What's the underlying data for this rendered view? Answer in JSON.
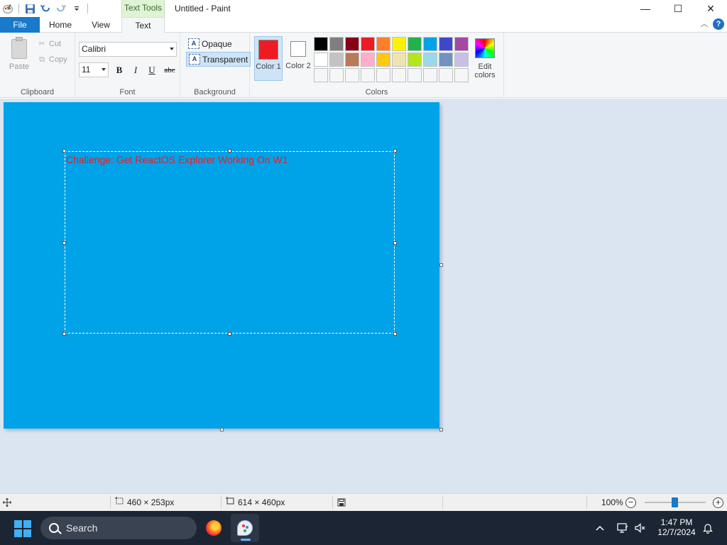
{
  "window": {
    "title": "Untitled - Paint",
    "context_tab": "Text Tools",
    "min": "—",
    "max": "☐",
    "close": "✕"
  },
  "tabs": {
    "file": "File",
    "home": "Home",
    "view": "View",
    "text": "Text"
  },
  "ribbon": {
    "clipboard": {
      "label": "Clipboard",
      "paste": "Paste",
      "cut": "Cut",
      "copy": "Copy"
    },
    "font": {
      "label": "Font",
      "name": "Calibri",
      "size": "11",
      "bold": "B",
      "italic": "I",
      "underline": "U",
      "strike": "abc"
    },
    "background": {
      "label": "Background",
      "opaque": "Opaque",
      "transparent": "Transparent",
      "selected": "transparent"
    },
    "colors": {
      "label": "Colors",
      "color1_label": "Color 1",
      "color2_label": "Color 2",
      "color1": "#ed1c24",
      "color2": "#ffffff",
      "edit_label": "Edit colors",
      "palette_row1": [
        "#000000",
        "#7f7f7f",
        "#880015",
        "#ed1c24",
        "#ff7f27",
        "#fff200",
        "#22b14c",
        "#00a2e8",
        "#3f48cc",
        "#a349a4"
      ],
      "palette_row2": [
        "#ffffff",
        "#c3c3c3",
        "#b97a57",
        "#ffaec9",
        "#ffc90e",
        "#efe4b0",
        "#b5e61d",
        "#99d9ea",
        "#7092be",
        "#c8bfe7"
      ]
    }
  },
  "canvas": {
    "background": "#00a2e8",
    "text": "Challenge: Get ReactOS Explorer Working On W1"
  },
  "status": {
    "selection_size": "460 × 253px",
    "image_size": "614 × 460px",
    "zoom": "100%"
  },
  "taskbar": {
    "search_placeholder": "Search",
    "time": "1:47 PM",
    "date": "12/7/2024"
  }
}
